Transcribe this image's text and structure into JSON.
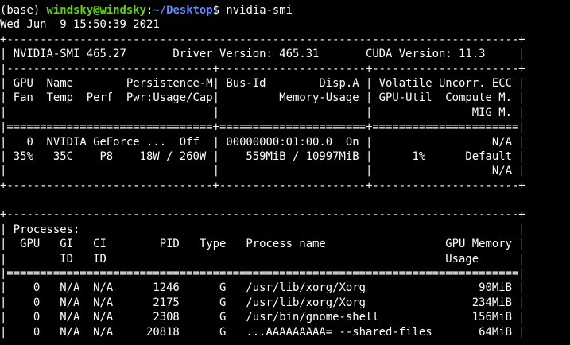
{
  "terminal": {
    "prompt": {
      "env": "(base) ",
      "user_host": "windsky@windsky",
      "colon": ":",
      "path": "~/Desktop",
      "dollar": "$ ",
      "command": "nvidia-smi"
    },
    "colors": {
      "background": "#000000",
      "text": "#ffffff",
      "user_host": "#5fd700",
      "path": "#5f87ff"
    },
    "output": [
      "Wed Jun  9 15:50:39 2021",
      "+-----------------------------------------------------------------------------+",
      "| NVIDIA-SMI 465.27       Driver Version: 465.31       CUDA Version: 11.3     |",
      "|-------------------------------+----------------------+----------------------+",
      "| GPU  Name        Persistence-M| Bus-Id        Disp.A | Volatile Uncorr. ECC |",
      "| Fan  Temp  Perf  Pwr:Usage/Cap|         Memory-Usage | GPU-Util  Compute M. |",
      "|                               |                      |               MIG M. |",
      "|===============================+======================+======================|",
      "|   0  NVIDIA GeForce ...  Off  | 00000000:01:00.0  On |                  N/A |",
      "| 35%   35C    P8    18W / 260W |    559MiB / 10997MiB |      1%      Default |",
      "|                               |                      |                  N/A |",
      "+-------------------------------+----------------------+----------------------+",
      "",
      "+-----------------------------------------------------------------------------+",
      "| Processes:                                                                  |",
      "|  GPU   GI   CI        PID   Type   Process name                  GPU Memory |",
      "|        ID   ID                                                   Usage      |",
      "|=============================================================================|",
      "|    0   N/A  N/A      1246      G   /usr/lib/xorg/Xorg                 90MiB |",
      "|    0   N/A  N/A      2175      G   /usr/lib/xorg/Xorg                234MiB |",
      "|    0   N/A  N/A      2308      G   /usr/bin/gnome-shell              156MiB |",
      "|    0   N/A  N/A     20818      G   ...AAAAAAAAA= --shared-files       64MiB |"
    ]
  }
}
